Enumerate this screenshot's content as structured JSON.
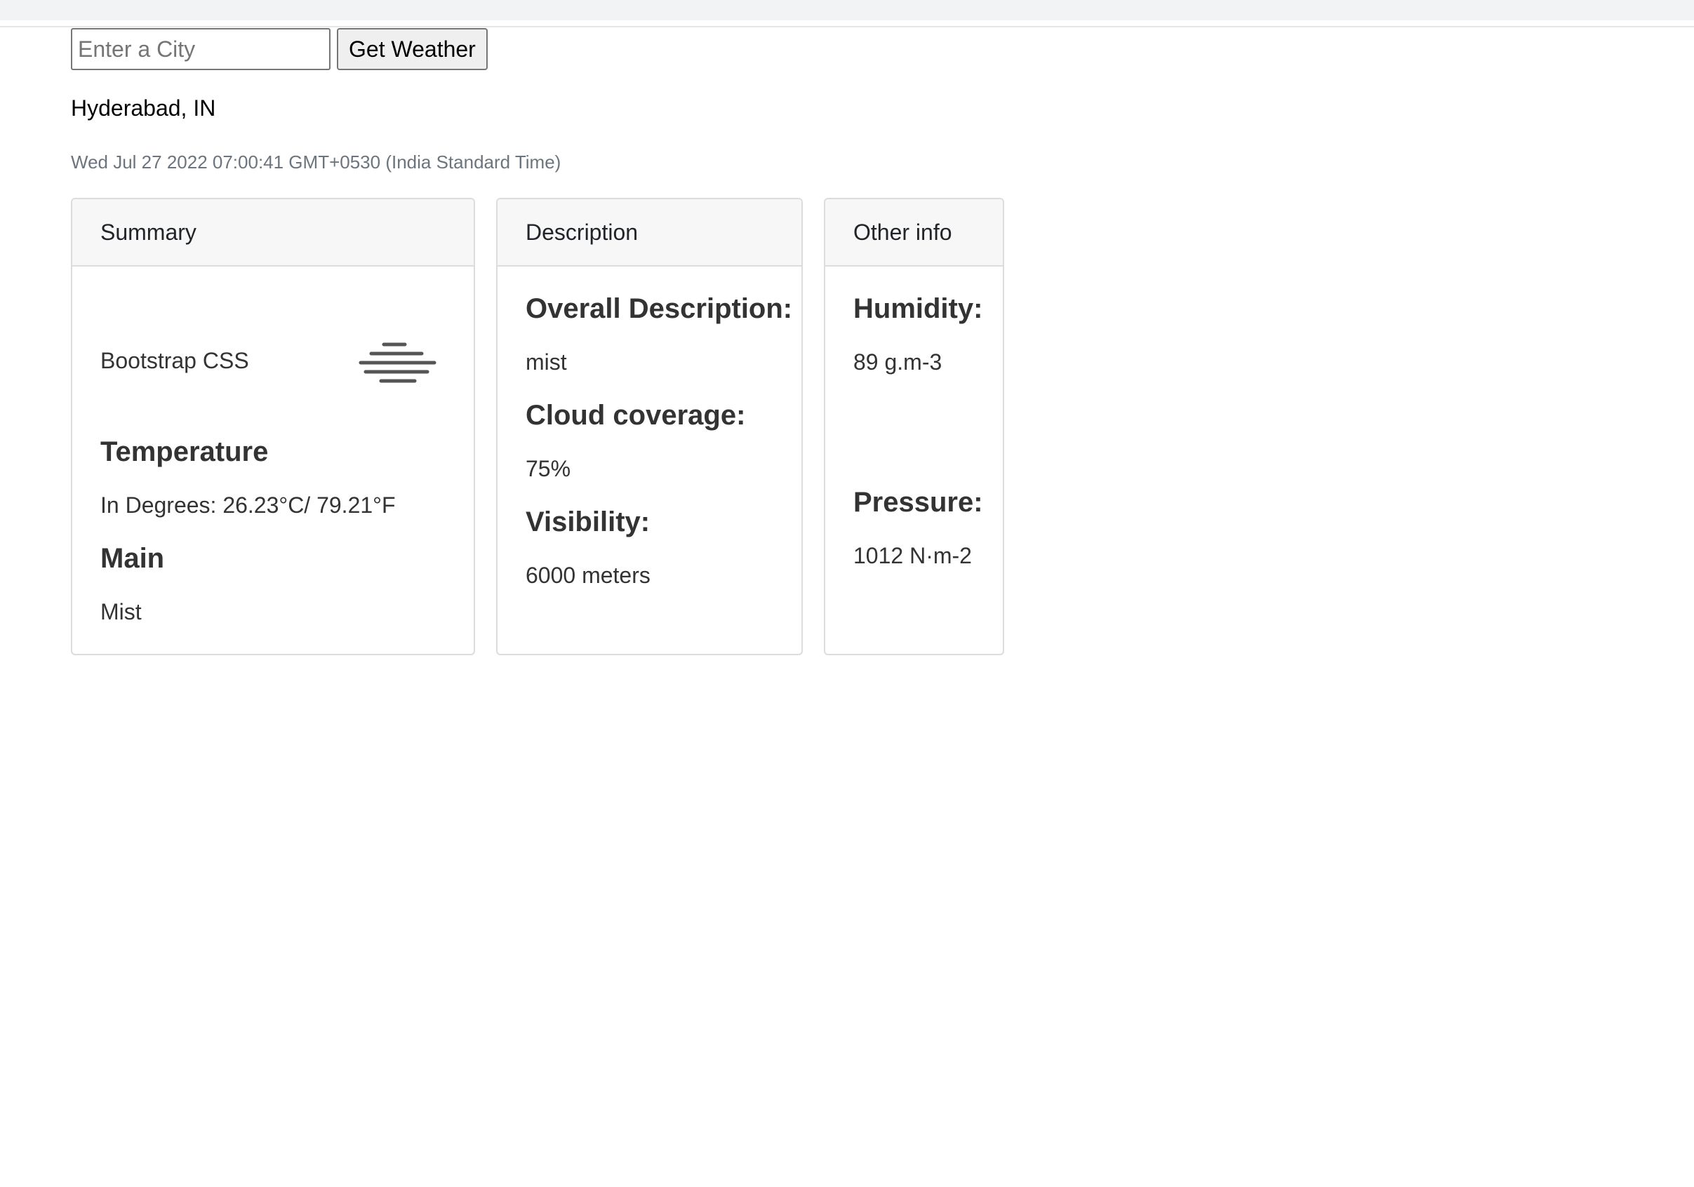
{
  "search": {
    "placeholder": "Enter a City",
    "button_label": "Get Weather"
  },
  "location": "Hyderabad, IN",
  "datetime": "Wed Jul 27 2022 07:00:41 GMT+0530 (India Standard Time)",
  "summary": {
    "header": "Summary",
    "icon_alt": "Bootstrap CSS",
    "icon": "mist-icon",
    "temperature_title": "Temperature",
    "temperature_text": "In Degrees: 26.23°C/ 79.21°F",
    "main_title": "Main",
    "main_value": "Mist"
  },
  "description": {
    "header": "Description",
    "overall_title": "Overall Description:",
    "overall_value": "mist",
    "cloud_title": "Cloud coverage:",
    "cloud_value": "75%",
    "visibility_title": "Visibility:",
    "visibility_value": "6000 meters"
  },
  "other": {
    "header": "Other info",
    "humidity_title": "Humidity:",
    "humidity_value": "89 g.m-3",
    "pressure_title": "Pressure:",
    "pressure_value": "1012 N·m-2"
  }
}
